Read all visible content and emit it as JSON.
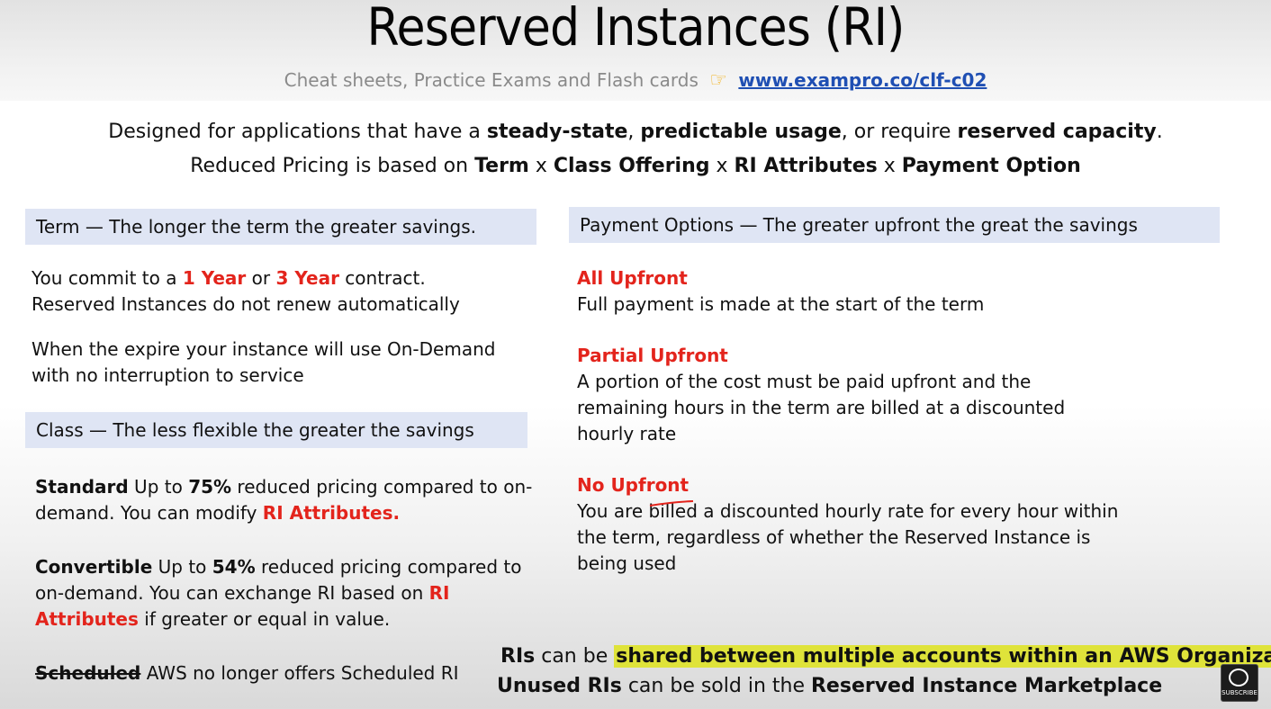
{
  "header": {
    "title": "Reserved Instances (RI)",
    "subtitle_text": "Cheat sheets, Practice Exams and Flash cards",
    "subtitle_link": "www.exampro.co/clf-c02"
  },
  "intro": {
    "line1": {
      "p1": "Designed for applications that have a ",
      "b1": "steady-state",
      "p2": ", ",
      "b2": "predictable usage",
      "p3": ", or require ",
      "b3": "reserved capacity",
      "p4": "."
    },
    "line2": {
      "p1": "Reduced Pricing is based on ",
      "b1": "Term",
      "x1": " x ",
      "b2": "Class Offering",
      "x2": " x ",
      "b3": "RI Attributes",
      "x3": " x  ",
      "b4": "Payment Option"
    }
  },
  "term": {
    "header": "Term — The longer the term the greater savings.",
    "p1_a": "You commit to a ",
    "p1_red1": "1 Year",
    "p1_b": " or ",
    "p1_red2": "3 Year",
    "p1_c": " contract.",
    "p1_line2": "Reserved Instances do not renew automatically",
    "p2_line1": "When the expire your instance will use On-Demand",
    "p2_line2": "with no interruption to service"
  },
  "class": {
    "header": "Class — The less flexible the greater the savings",
    "standard": {
      "label": "Standard",
      "a": " Up to ",
      "pct": "75%",
      "b": " reduced pricing compared to on-demand. You can modify ",
      "red": "RI Attributes."
    },
    "convertible": {
      "label": "Convertible",
      "a": " Up to ",
      "pct": "54%",
      "b": " reduced pricing compared to on-demand.  You can exchange RI based on ",
      "red": "RI Attributes",
      "c": " if greater or equal in value."
    },
    "scheduled": {
      "label": "Scheduled",
      "text": " AWS no longer offers Scheduled RI"
    }
  },
  "payment": {
    "header": "Payment Options —  The greater upfront the great the savings",
    "all_title": "All Upfront",
    "all_text": "Full payment is made at the start of the term",
    "partial_title": "Partial Upfront",
    "partial_l1": "A portion of the cost must be paid upfront and the",
    "partial_l2": "remaining hours in the term are billed at a discounted",
    "partial_l3": "hourly rate",
    "no_title": "No Upfront",
    "no_l1": "You are billed a discounted hourly rate for every hour within",
    "no_l2": "the term, regardless of whether the Reserved Instance is",
    "no_l3": "being used"
  },
  "bottom": {
    "line1_b": "RIs",
    "line1_a": " can be ",
    "line1_hl": "shared between multiple accounts within an AWS Organization",
    "line2_b": "Unused RIs",
    "line2_a": " can be sold in the ",
    "line2_b2": "Reserved Instance Marketplace"
  },
  "logo": {
    "label": "SUBSCRIBE",
    "icon": "freecodecamp-logo-icon"
  },
  "colors": {
    "accent_red": "#e3241c",
    "header_bg": "#dfe5f4",
    "highlight": "#dfe33a",
    "link": "#1f4fb3"
  }
}
